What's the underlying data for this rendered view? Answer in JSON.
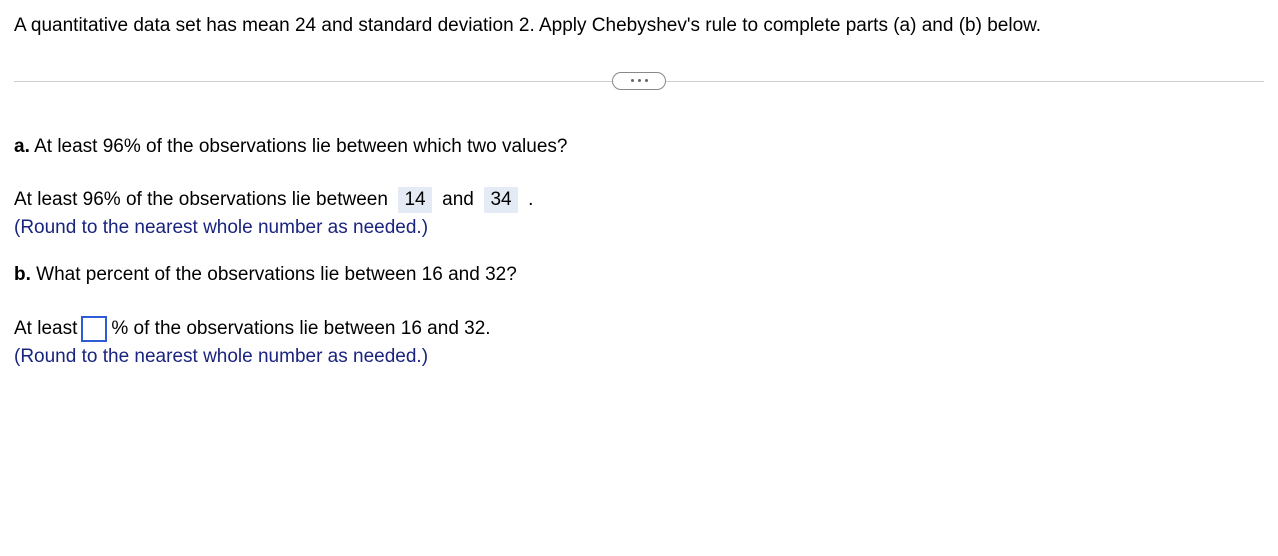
{
  "prompt": "A quantitative data set has mean 24 and standard deviation 2. Apply Chebyshev's rule to complete parts (a) and (b) below.",
  "partA": {
    "label": "a.",
    "question": "At least 96% of the observations lie between which two values?",
    "answerPrefix": "At least 96% of the observations lie between",
    "value1": "14",
    "andText": "and",
    "value2": "34",
    "period": ".",
    "instruction": "(Round to the nearest whole number as needed.)"
  },
  "partB": {
    "label": "b.",
    "question": "What percent of the observations lie between 16 and 32?",
    "answerPrefix": "At least",
    "answerSuffix": "% of the observations lie between 16 and 32.",
    "instruction": "(Round to the nearest whole number as needed.)"
  }
}
